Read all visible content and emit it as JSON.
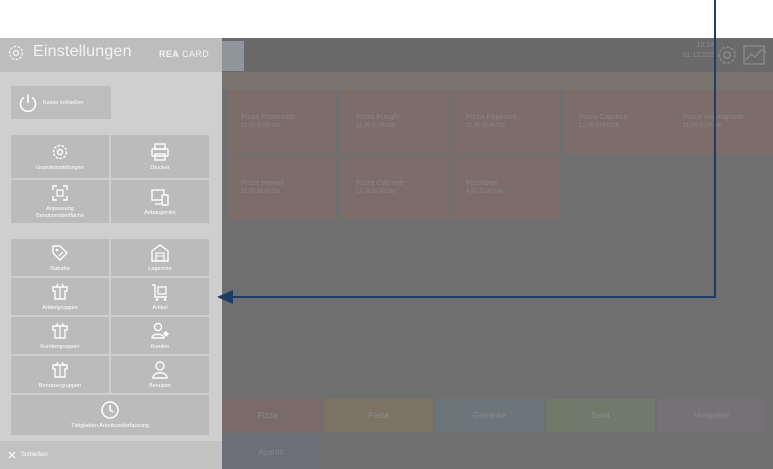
{
  "panel": {
    "title": "Einstellungen",
    "brand_bold": "REA",
    "brand_rest": " CARD",
    "close_register_label": "Kasse schließen",
    "groups": [
      {
        "tiles": [
          {
            "label": "Grundeinstellungen",
            "icon": "gear-icon"
          },
          {
            "label": "Drucker",
            "icon": "printer-icon"
          },
          {
            "label": "Anpassung\nBenutzeroberfläche",
            "icon": "layout-adjust-icon"
          },
          {
            "label": "Anbaugeräte",
            "icon": "devices-icon"
          }
        ]
      },
      {
        "tiles": [
          {
            "label": "Rabatte",
            "icon": "discount-tag-icon"
          },
          {
            "label": "Lagerorte",
            "icon": "warehouse-icon"
          },
          {
            "label": "Artikelgruppen",
            "icon": "box-group-icon"
          },
          {
            "label": "Artikel",
            "icon": "article-cart-icon"
          },
          {
            "label": "Kundengruppen",
            "icon": "box-group-icon"
          },
          {
            "label": "Kunden",
            "icon": "customer-icon"
          },
          {
            "label": "Benutzergruppen",
            "icon": "box-group-icon"
          },
          {
            "label": "Benutzer",
            "icon": "user-icon"
          },
          {
            "label": "Tätigkeiten Arbeitszeiterfassung",
            "icon": "clock-icon"
          }
        ]
      }
    ],
    "footer_label": "Schließen"
  },
  "app": {
    "time": "10:14",
    "date": "01.12.202",
    "products": [
      {
        "name": "Pizza Prosciutto",
        "price": "11,00 EUR/Stk"
      },
      {
        "name": "Pizza Funghi",
        "price": "11,00 EUR/Stk"
      },
      {
        "name": "Pizza Peperoni",
        "price": "11,00 EUR/Stk"
      },
      {
        "name": "Pizza Caprese",
        "price": "12,00 EUR/Stk"
      },
      {
        "name": "Pizza Vegetariana",
        "price": "11,50 EUR/Stk"
      },
      {
        "name": "Pizza Hawaii",
        "price": "11,00 EUR/Stk"
      },
      {
        "name": "Pizza Calzone",
        "price": "12,00 EUR/Stk"
      },
      {
        "name": "Pizzabrot",
        "price": "4,50 EUR/Stk"
      }
    ],
    "categories": [
      {
        "label": "Pizza",
        "color": "#7a6a68"
      },
      {
        "label": "Pasta",
        "color": "#7c7364"
      },
      {
        "label": "Getränke",
        "color": "#6c7578"
      },
      {
        "label": "Salat",
        "color": "#6f7a6b"
      },
      {
        "label": "Vorspeise",
        "color": "#757175"
      }
    ],
    "aperitif_label": "Aperitif"
  },
  "colors": {
    "panel_bg": "#cfcfcf",
    "tile_bg": "#bbbbbb",
    "arrow": "#1c3d66"
  }
}
